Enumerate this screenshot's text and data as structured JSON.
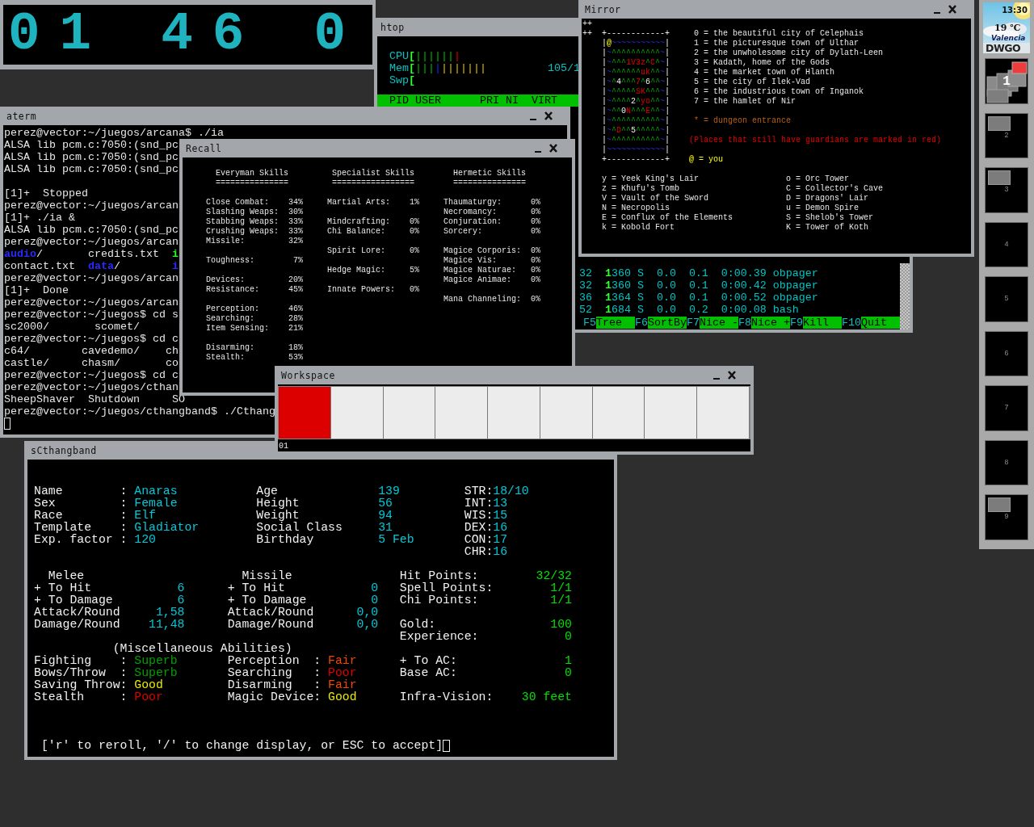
{
  "clock": {
    "digit_groups": [
      "01",
      "46",
      "0"
    ]
  },
  "htop": {
    "title": "htop",
    "meters": [
      {
        "label": "CPU",
        "bracket": "[",
        "segments": [
          {
            "kind": "normal",
            "text": "||||||"
          },
          {
            "kind": "kernel",
            "text": "|"
          }
        ]
      },
      {
        "label": "Mem",
        "bracket": "[",
        "segments": [
          {
            "kind": "used",
            "text": "|||"
          },
          {
            "kind": "buffers",
            "text": "|"
          },
          {
            "kind": "cache",
            "text": "|||||||"
          }
        ],
        "reading": "105/1"
      },
      {
        "label": "Swp",
        "bracket": "["
      }
    ],
    "header": [
      "PID",
      "USER",
      "PRI",
      "NI",
      "VIRT"
    ],
    "rows": [
      {
        "res_tail": "32",
        "shr_thousands": "1",
        "shr_rest": "360",
        "state": "S",
        "cpu": "0.0",
        "mem": "0.1",
        "time": "0:00.39",
        "command": "obpager"
      },
      {
        "res_tail": "32",
        "shr_thousands": "1",
        "shr_rest": "360",
        "state": "S",
        "cpu": "0.0",
        "mem": "0.1",
        "time": "0:00.42",
        "command": "obpager"
      },
      {
        "res_tail": "36",
        "shr_thousands": "1",
        "shr_rest": "364",
        "state": "S",
        "cpu": "0.0",
        "mem": "0.1",
        "time": "0:00.52",
        "command": "obpager"
      },
      {
        "res_tail": "52",
        "shr_thousands": "1",
        "shr_rest": "684",
        "state": "S",
        "cpu": "0.0",
        "mem": "0.2",
        "time": "0:00.08",
        "command": "bash"
      }
    ],
    "function_keys": [
      {
        "key": "F5",
        "label": "Tree"
      },
      {
        "key": "F6",
        "label": "SortBy"
      },
      {
        "key": "F7",
        "label": "Nice -"
      },
      {
        "key": "F8",
        "label": "Nice +"
      },
      {
        "key": "F9",
        "label": "Kill"
      },
      {
        "key": "F10",
        "label": "Quit"
      }
    ]
  },
  "aterm": {
    "title": "aterm",
    "blocks": [
      [
        [
          {
            "kind": "plain",
            "text": "perez@vector:~/juegos/arcana$ ./ia"
          }
        ],
        [
          {
            "kind": "plain",
            "text": "ALSA lib pcm.c:7050:(snd_pc"
          }
        ],
        [
          {
            "kind": "plain",
            "text": "ALSA lib pcm.c:7050:(snd_pc"
          }
        ],
        [
          {
            "kind": "plain",
            "text": "ALSA lib pcm.c:7050:(snd_pc"
          }
        ]
      ],
      [
        [
          {
            "kind": "plain",
            "text": "[1]+  Stopped"
          }
        ],
        [
          {
            "kind": "plain",
            "text": "perez@vector:~/juegos/arcan"
          }
        ],
        [
          {
            "kind": "plain",
            "text": "[1]+ ./ia &"
          }
        ],
        [
          {
            "kind": "plain",
            "text": "ALSA lib pcm.c:7050:(snd_pc"
          }
        ],
        [
          {
            "kind": "plain",
            "text": "perez@vector:~/juegos/arcan"
          }
        ],
        [
          {
            "kind": "directory",
            "text": "audio"
          },
          {
            "kind": "plain",
            "text": "/       credits.txt  "
          },
          {
            "kind": "executable",
            "text": "i"
          }
        ],
        [
          {
            "kind": "plain",
            "text": "contact.txt  "
          },
          {
            "kind": "directory",
            "text": "data"
          },
          {
            "kind": "plain",
            "text": "/        "
          },
          {
            "kind": "directory",
            "text": "i"
          }
        ],
        [
          {
            "kind": "plain",
            "text": "perez@vector:~/juegos/arcan"
          }
        ],
        [
          {
            "kind": "plain",
            "text": "[1]+  Done"
          }
        ],
        [
          {
            "kind": "plain",
            "text": "perez@vector:~/juegos/arcan"
          }
        ],
        [
          {
            "kind": "plain",
            "text": "perez@vector:~/juegos$ cd s"
          }
        ],
        [
          {
            "kind": "plain",
            "text": "sc2000/       scomet/"
          }
        ],
        [
          {
            "kind": "plain",
            "text": "perez@vector:~/juegos$ cd c"
          }
        ],
        [
          {
            "kind": "plain",
            "text": "c64/        cavedemo/    ch"
          }
        ],
        [
          {
            "kind": "plain",
            "text": "castle/     chasm/       co"
          }
        ],
        [
          {
            "kind": "plain",
            "text": "perez@vector:~/juegos$ cd c"
          }
        ],
        [
          {
            "kind": "plain",
            "text": "perez@vector:~/juegos/cthan"
          }
        ],
        [
          {
            "kind": "plain",
            "text": "SheepShaver  Shutdown     SO"
          }
        ],
        [
          {
            "kind": "plain",
            "text": "perez@vector:~/juegos/cthangband$ ./Cthang"
          }
        ]
      ]
    ]
  },
  "recall": {
    "title": "Recall",
    "columns": [
      {
        "title": "Everyman Skills",
        "rule": "===============",
        "groups": [
          [
            {
              "label": "Close Combat:",
              "value": "34%"
            },
            {
              "label": "Slashing Weaps:",
              "value": "30%"
            },
            {
              "label": "Stabbing Weaps:",
              "value": "33%"
            },
            {
              "label": "Crushing Weaps:",
              "value": "33%"
            },
            {
              "label": "Missile:",
              "value": "32%"
            }
          ],
          [
            {
              "label": "Toughness:",
              "value": "7%"
            }
          ],
          [
            {
              "label": "Devices:",
              "value": "20%"
            },
            {
              "label": "Resistance:",
              "value": "45%"
            }
          ],
          [
            {
              "label": "Perception:",
              "value": "46%"
            },
            {
              "label": "Searching:",
              "value": "28%"
            },
            {
              "label": "Item Sensing:",
              "value": "21%"
            }
          ],
          [
            {
              "label": "Disarming:",
              "value": "18%"
            },
            {
              "label": "Stealth:",
              "value": "53%"
            }
          ]
        ]
      },
      {
        "title": "Specialist Skills",
        "rule": "=================",
        "groups": [
          [
            {
              "label": "Martial Arts:",
              "value": "1%"
            }
          ],
          [
            {
              "label": "Mindcrafting:",
              "value": "0%"
            },
            {
              "label": "Chi Balance:",
              "value": "0%"
            }
          ],
          [
            {
              "label": "Spirit Lore:",
              "value": "0%"
            }
          ],
          [
            {
              "label": "Hedge Magic:",
              "value": "5%"
            }
          ],
          [
            {
              "label": "Innate Powers:",
              "value": "0%"
            }
          ]
        ]
      },
      {
        "title": "Hermetic Skills",
        "rule": "===============",
        "groups": [
          [
            {
              "label": "Thaumaturgy:",
              "value": "0%"
            },
            {
              "label": "Necromancy:",
              "value": "0%"
            },
            {
              "label": "Conjuration:",
              "value": "0%"
            },
            {
              "label": "Sorcery:",
              "value": "0%"
            }
          ],
          [
            {
              "label": "Magice Corporis:",
              "value": "0%"
            },
            {
              "label": "Magice Vis:",
              "value": "0%"
            },
            {
              "label": "Magice Naturae:",
              "value": "0%"
            },
            {
              "label": "Magice Animae:",
              "value": "0%"
            }
          ],
          [
            {
              "label": "Mana Channeling:",
              "value": "0%"
            }
          ]
        ]
      }
    ]
  },
  "mirror": {
    "title": "Mirror",
    "corner_marks": [
      "++",
      "++"
    ],
    "map_rows": [
      [
        {
          "kind": "border",
          "text": "+------------+"
        }
      ],
      [
        {
          "kind": "border",
          "text": "|"
        },
        {
          "kind": "you",
          "text": "@"
        },
        {
          "kind": "water",
          "text": "~~~~~~~~~~~"
        },
        {
          "kind": "border",
          "text": "|"
        }
      ],
      [
        {
          "kind": "border",
          "text": "|"
        },
        {
          "kind": "water",
          "text": "~"
        },
        {
          "kind": "mountain",
          "text": "^^^^^^^^^^"
        },
        {
          "kind": "water",
          "text": "~"
        },
        {
          "kind": "border",
          "text": "|"
        }
      ],
      [
        {
          "kind": "border",
          "text": "|"
        },
        {
          "kind": "water",
          "text": "~"
        },
        {
          "kind": "mountain",
          "text": "^^^"
        },
        {
          "kind": "guardian",
          "text": "1V3z"
        },
        {
          "kind": "mountain",
          "text": "^"
        },
        {
          "kind": "guardian",
          "text": "C"
        },
        {
          "kind": "mountain",
          "text": "^"
        },
        {
          "kind": "water",
          "text": "~"
        },
        {
          "kind": "border",
          "text": "|"
        }
      ],
      [
        {
          "kind": "border",
          "text": "|"
        },
        {
          "kind": "water",
          "text": "~"
        },
        {
          "kind": "mountain",
          "text": "^^^^^^"
        },
        {
          "kind": "guardian",
          "text": "uk"
        },
        {
          "kind": "mountain",
          "text": "^^"
        },
        {
          "kind": "water",
          "text": "~"
        },
        {
          "kind": "border",
          "text": "|"
        }
      ],
      [
        {
          "kind": "border",
          "text": "|"
        },
        {
          "kind": "water",
          "text": "~"
        },
        {
          "kind": "mountain",
          "text": "^"
        },
        {
          "kind": "town",
          "text": "4"
        },
        {
          "kind": "mountain",
          "text": "^^^"
        },
        {
          "kind": "guardian",
          "text": "7"
        },
        {
          "kind": "mountain",
          "text": "^"
        },
        {
          "kind": "town",
          "text": "6"
        },
        {
          "kind": "mountain",
          "text": "^^"
        },
        {
          "kind": "water",
          "text": "~"
        },
        {
          "kind": "border",
          "text": "|"
        }
      ],
      [
        {
          "kind": "border",
          "text": "|"
        },
        {
          "kind": "water",
          "text": "~"
        },
        {
          "kind": "mountain",
          "text": "^^^^^"
        },
        {
          "kind": "guardian",
          "text": "SK"
        },
        {
          "kind": "mountain",
          "text": "^^^"
        },
        {
          "kind": "water",
          "text": "~"
        },
        {
          "kind": "border",
          "text": "|"
        }
      ],
      [
        {
          "kind": "border",
          "text": "|"
        },
        {
          "kind": "water",
          "text": "~"
        },
        {
          "kind": "mountain",
          "text": "^^^^"
        },
        {
          "kind": "town",
          "text": "2"
        },
        {
          "kind": "mountain",
          "text": "^"
        },
        {
          "kind": "guardian",
          "text": "yo"
        },
        {
          "kind": "mountain",
          "text": "^^"
        },
        {
          "kind": "water",
          "text": "~"
        },
        {
          "kind": "border",
          "text": "|"
        }
      ],
      [
        {
          "kind": "border",
          "text": "|"
        },
        {
          "kind": "water",
          "text": "~"
        },
        {
          "kind": "mountain",
          "text": "^^"
        },
        {
          "kind": "town",
          "text": "0"
        },
        {
          "kind": "guardian",
          "text": "N"
        },
        {
          "kind": "mountain",
          "text": "^^^"
        },
        {
          "kind": "guardian",
          "text": "E"
        },
        {
          "kind": "mountain",
          "text": "^^"
        },
        {
          "kind": "water",
          "text": "~"
        },
        {
          "kind": "border",
          "text": "|"
        }
      ],
      [
        {
          "kind": "border",
          "text": "|"
        },
        {
          "kind": "water",
          "text": "~"
        },
        {
          "kind": "mountain",
          "text": "^^^^^^^^^^"
        },
        {
          "kind": "water",
          "text": "~"
        },
        {
          "kind": "border",
          "text": "|"
        }
      ],
      [
        {
          "kind": "border",
          "text": "|"
        },
        {
          "kind": "water",
          "text": "~"
        },
        {
          "kind": "mountain",
          "text": "^"
        },
        {
          "kind": "guardian",
          "text": "D"
        },
        {
          "kind": "mountain",
          "text": "^^"
        },
        {
          "kind": "town",
          "text": "5"
        },
        {
          "kind": "mountain",
          "text": "^^^^^"
        },
        {
          "kind": "water",
          "text": "~"
        },
        {
          "kind": "border",
          "text": "|"
        }
      ],
      [
        {
          "kind": "border",
          "text": "|"
        },
        {
          "kind": "water",
          "text": "~"
        },
        {
          "kind": "mountain",
          "text": "^^^^^^^^^^"
        },
        {
          "kind": "water",
          "text": "~"
        },
        {
          "kind": "border",
          "text": "|"
        }
      ],
      [
        {
          "kind": "border",
          "text": "|"
        },
        {
          "kind": "water",
          "text": "~~~~~~~~~~~~"
        },
        {
          "kind": "border",
          "text": "|"
        }
      ],
      [
        {
          "kind": "border",
          "text": "+------------+"
        }
      ]
    ],
    "towns": [
      "0 = the beautiful city of Celephais",
      "1 = the picturesque town of Ulthar",
      "2 = the unwholesome city of Dylath-Leen",
      "3 = Kadath, home of the Gods",
      "4 = the market town of Hlanth",
      "5 = the city of Ilek-Vad",
      "6 = the industrious town of Inganok",
      "7 = the hamlet of Nir"
    ],
    "notes": [
      {
        "kind": "dungeon",
        "text": "* = dungeon entrance"
      },
      {
        "kind": "guardians",
        "text": "(Places that still have guardians are marked in red)"
      },
      {
        "kind": "you",
        "text": "@ = you"
      }
    ],
    "dungeons_left": [
      "y = Yeek King's Lair",
      "z = Khufu's Tomb",
      "V = Vault of the Sword",
      "N = Necropolis",
      "E = Conflux of the Elements",
      "k = Kobold Fort"
    ],
    "dungeons_right": [
      "o = Orc Tower",
      "C = Collector's Cave",
      "D = Dragons' Lair",
      "u = Demon Spire",
      "S = Shelob's Tower",
      "K = Tower of Koth"
    ]
  },
  "workspace": {
    "title": "Workspace",
    "desktops": [
      {
        "selected": true
      },
      {
        "selected": false
      },
      {
        "selected": false
      },
      {
        "selected": false
      },
      {
        "selected": false
      },
      {
        "selected": false
      },
      {
        "selected": false
      },
      {
        "selected": false
      },
      {
        "selected": false
      }
    ],
    "label": "01"
  },
  "character": {
    "title": "sCthangband",
    "identity": [
      {
        "label": "Name",
        "colon": ":",
        "value": "Anaras"
      },
      {
        "label": "Sex",
        "colon": ":",
        "value": "Female"
      },
      {
        "label": "Race",
        "colon": ":",
        "value": "Elf"
      },
      {
        "label": "Template",
        "colon": ":",
        "value": "Gladiator"
      },
      {
        "label": "Exp. factor",
        "colon": ":",
        "value": "120"
      }
    ],
    "physical": [
      {
        "label": "Age",
        "value": "139"
      },
      {
        "label": "Height",
        "value": "56"
      },
      {
        "label": "Weight",
        "value": "94"
      },
      {
        "label": "Social Class",
        "value": "31"
      },
      {
        "label": "Birthday",
        "value": "5 Feb"
      }
    ],
    "stats": [
      {
        "label": "STR:",
        "value": "18/10"
      },
      {
        "label": "INT:",
        "value": "13"
      },
      {
        "label": "WIS:",
        "value": "15"
      },
      {
        "label": "DEX:",
        "value": "16"
      },
      {
        "label": "CON:",
        "value": "17"
      },
      {
        "label": "CHR:",
        "value": "16"
      }
    ],
    "melee": {
      "title": "Melee",
      "rows": [
        {
          "label": "+ To Hit",
          "value": "6"
        },
        {
          "label": "+ To Damage",
          "value": "6"
        },
        {
          "label": "Attack/Round",
          "value": "1,58"
        },
        {
          "label": "Damage/Round",
          "value": "11,48"
        }
      ]
    },
    "missile": {
      "title": "Missile",
      "rows": [
        {
          "label": "+ To Hit",
          "value": "0"
        },
        {
          "label": "+ To Damage",
          "value": "0"
        },
        {
          "label": "Attack/Round",
          "value": "0,0"
        },
        {
          "label": "Damage/Round",
          "value": "0,0"
        }
      ]
    },
    "points": [
      [
        {
          "label": "Hit Points:",
          "value": "32/32"
        },
        {
          "label": "Spell Points:",
          "value": "1/1"
        },
        {
          "label": "Chi Points:",
          "value": "1/1"
        }
      ],
      [
        {
          "label": "Gold:",
          "value": "100"
        },
        {
          "label": "Experience:",
          "value": "0"
        }
      ]
    ],
    "abilities_title": "(Miscellaneous Abilities)",
    "abilities": [
      [
        {
          "label": "Fighting",
          "colon": ":",
          "value": "Superb",
          "color": "#00a000"
        },
        {
          "label": "Bows/Throw",
          "colon": ":",
          "value": "Superb",
          "color": "#00a000"
        },
        {
          "label": "Saving Throw",
          "colon": ":",
          "value": "Good",
          "color": "#e8e800"
        },
        {
          "label": "Stealth",
          "colon": ":",
          "value": "Poor",
          "color": "#e00000"
        }
      ],
      [
        {
          "label": "Perception",
          "colon": ":",
          "value": "Fair",
          "color": "#f04800"
        },
        {
          "label": "Searching",
          "colon": ":",
          "value": "Poor",
          "color": "#e00000"
        },
        {
          "label": "Disarming",
          "colon": ":",
          "value": "Fair",
          "color": "#f04800"
        },
        {
          "label": "Magic Device",
          "colon": ":",
          "value": "Good",
          "color": "#e8e800"
        }
      ]
    ],
    "armor": [
      [
        {
          "label": "+ To AC:",
          "value": "1"
        },
        {
          "label": "Base AC:",
          "value": "0"
        }
      ],
      [
        {
          "label": "Infra-Vision:",
          "value": "30 feet"
        }
      ]
    ],
    "prompt": "['r' to reroll, '/' to change display, or ESC to accept]"
  },
  "dock": {
    "weather": {
      "time": "13:30",
      "temperature": "19 ℃",
      "city": "Valencia",
      "station": "DWGO"
    },
    "desktops": [
      {
        "label": "1",
        "selected": true,
        "kind": "current"
      },
      {
        "label": "2",
        "selected": false,
        "kind": "occupied"
      },
      {
        "label": "3",
        "selected": false,
        "kind": "occupied"
      },
      {
        "label": "4",
        "selected": false,
        "kind": "empty"
      },
      {
        "label": "5",
        "selected": false,
        "kind": "empty"
      },
      {
        "label": "6",
        "selected": false,
        "kind": "empty"
      },
      {
        "label": "7",
        "selected": false,
        "kind": "empty"
      },
      {
        "label": "8",
        "selected": false,
        "kind": "empty"
      },
      {
        "label": "9",
        "selected": false,
        "kind": "occupied"
      }
    ]
  }
}
